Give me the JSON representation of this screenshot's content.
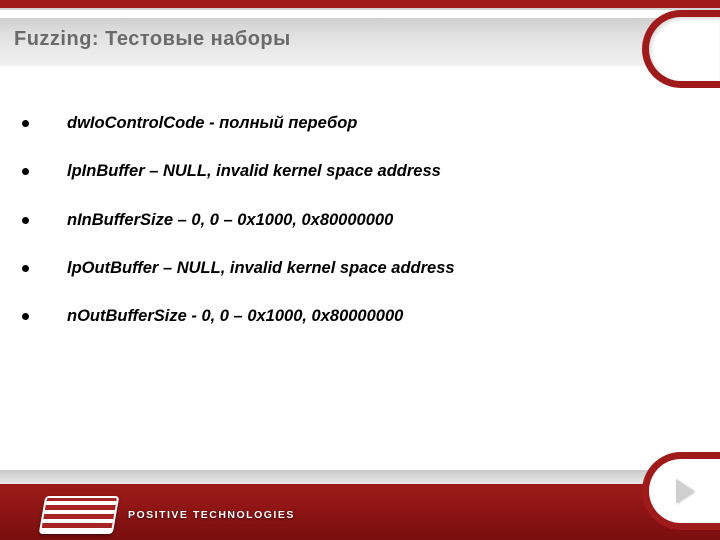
{
  "title": "Fuzzing: Тестовые наборы",
  "bullets": [
    "dwIoControlCode -  полный перебор",
    "lpInBuffer – NULL, invalid kernel space address",
    "nInBufferSize – 0, 0 – 0x1000, 0x80000000",
    "lpOutBuffer – NULL, invalid kernel space address",
    "nOutBufferSize - 0, 0 – 0x1000, 0x80000000"
  ],
  "brand": "POSITIVE TECHNOLOGIES"
}
